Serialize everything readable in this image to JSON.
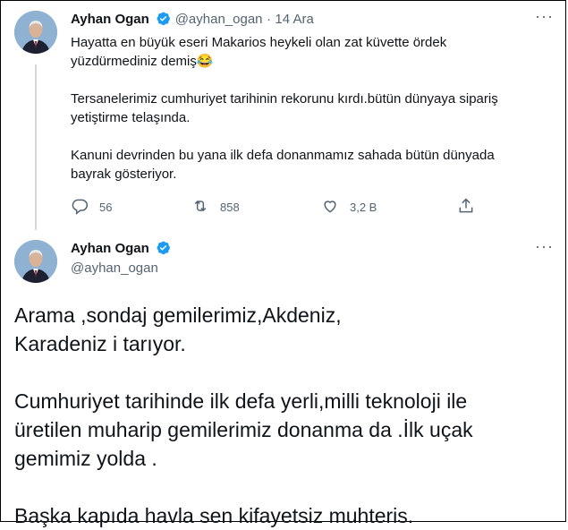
{
  "tweet1": {
    "author_name": "Ayhan Ogan",
    "handle": "@ayhan_ogan",
    "separator": "·",
    "date": "14 Ara",
    "more_label": "···",
    "lines": [
      "Hayatta en büyük eseri Makarios heykeli olan zat küvette ördek",
      "yüzdürmediniz demiş😂",
      "",
      "Tersanelerimiz cumhuriyet tarihinin rekorunu kırdı.bütün dünyaya sipariş",
      "yetiştirme telaşında.",
      "",
      "Kanuni devrinden bu yana ilk defa donanmamız sahada bütün dünyada",
      "bayrak gösteriyor."
    ],
    "actions": {
      "reply_count": "56",
      "retweet_count": "858",
      "like_count": "3,2 B"
    }
  },
  "tweet2": {
    "author_name": "Ayhan Ogan",
    "handle": "@ayhan_ogan",
    "more_label": "···",
    "lines": [
      "Arama ,sondaj gemilerimiz,Akdeniz,",
      "Karadeniz i tarıyor.",
      "",
      "Cumhuriyet tarihinde ilk defa yerli,milli teknoloji ile",
      "üretilen muharip gemilerimiz donanma da .İlk uçak",
      "gemimiz yolda .",
      "",
      "Başka kapıda havla sen kifayetsiz muhteris."
    ]
  },
  "colors": {
    "verified": "#1d9bf0",
    "secondary_text": "#536471",
    "thread_line": "#cfd9de"
  },
  "icons": [
    "verified-badge-icon",
    "reply-icon",
    "retweet-icon",
    "like-icon",
    "share-icon"
  ]
}
